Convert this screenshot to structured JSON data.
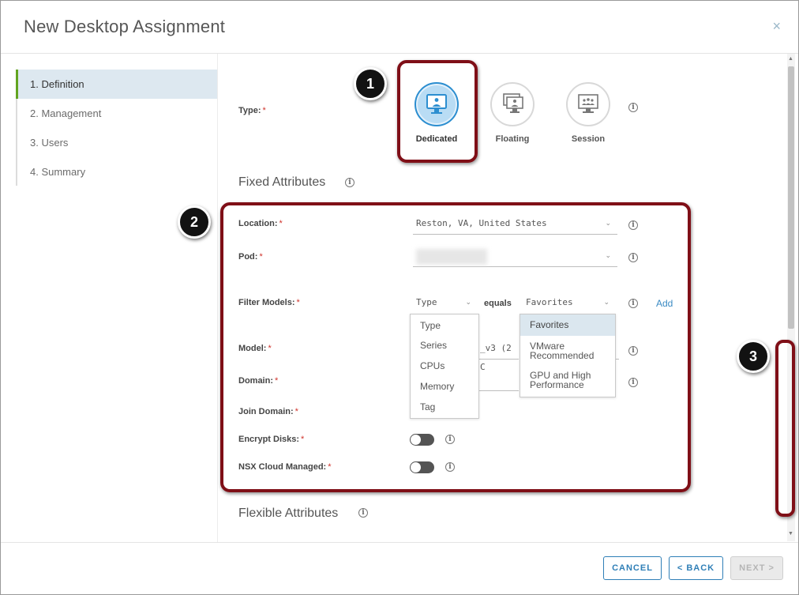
{
  "dialog": {
    "title": "New Desktop Assignment",
    "close": "×"
  },
  "sidebar": {
    "steps": [
      "1. Definition",
      "2. Management",
      "3. Users",
      "4. Summary"
    ],
    "active_index": 0
  },
  "type": {
    "label": "Type:",
    "options": [
      "Dedicated",
      "Floating",
      "Session"
    ],
    "selected": "Dedicated"
  },
  "fixed": {
    "title": "Fixed Attributes"
  },
  "flexible": {
    "title": "Flexible Attributes"
  },
  "fields": {
    "location": {
      "label": "Location:",
      "value": "Reston, VA, United States"
    },
    "pod": {
      "label": "Pod:",
      "value": ""
    },
    "filter_models": {
      "label": "Filter Models:",
      "field": "Type",
      "operator": "equals",
      "value": "Favorites",
      "add": "Add"
    },
    "model": {
      "label": "Model:",
      "value_fragment": "_v3 (2 C"
    },
    "domain": {
      "label": "Domain:"
    },
    "join_domain": {
      "label": "Join Domain:"
    },
    "encrypt_disks": {
      "label": "Encrypt Disks:",
      "enabled": false
    },
    "nsx_cloud": {
      "label": "NSX Cloud Managed:",
      "enabled": false
    }
  },
  "type_dropdown": [
    "Type",
    "Series",
    "CPUs",
    "Memory",
    "Tag"
  ],
  "favorites_dropdown": [
    "Favorites",
    "VMware Recommended",
    "GPU and High Performance"
  ],
  "required_marker": "*",
  "info_glyph": "i",
  "badges": [
    "1",
    "2",
    "3"
  ],
  "footer": {
    "cancel": "CANCEL",
    "back": "< BACK",
    "next": "NEXT >"
  },
  "colors": {
    "accent": "#2f7fb7",
    "callout": "#7f0f17",
    "active_step": "#62a420",
    "required": "#d0342c"
  },
  "icons": {
    "type_option": "monitor-icon",
    "info": "info-icon",
    "dropdown": "chevron-down-icon"
  }
}
